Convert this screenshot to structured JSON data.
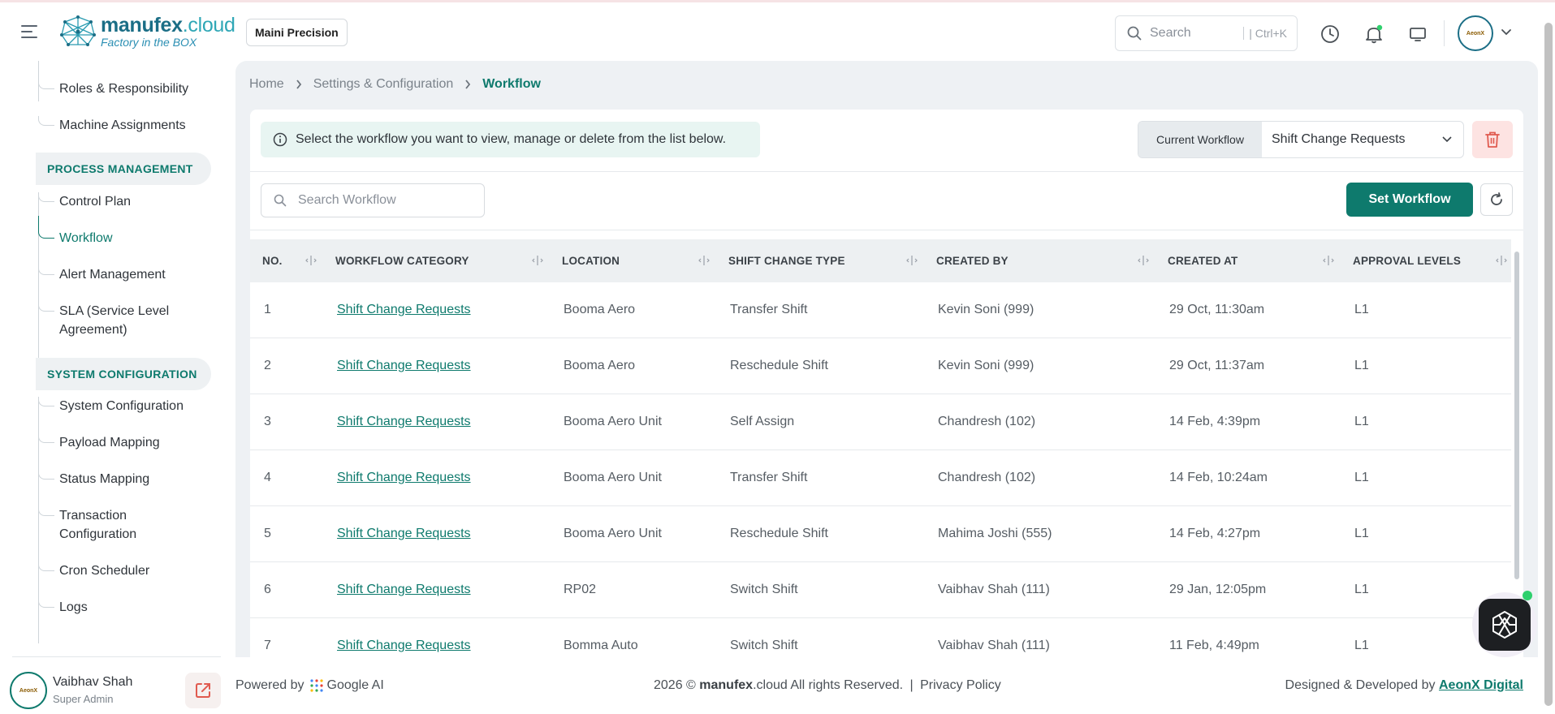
{
  "header": {
    "logo_name": "manufex",
    "logo_domain": ".cloud",
    "logo_tagline": "Factory in the BOX",
    "company": "Maini Precision",
    "search_placeholder": "Search",
    "search_shortcut": "| Ctrl+K",
    "icons": [
      "history-icon",
      "bell-icon",
      "monitor-icon"
    ],
    "avatar_text": "AeonX"
  },
  "sidebar": {
    "items_top": [
      "Roles & Responsibility",
      "Machine Assignments"
    ],
    "sections": [
      {
        "title": "PROCESS MANAGEMENT",
        "items": [
          "Control Plan",
          "Workflow",
          "Alert Management",
          "SLA (Service Level Agreement)"
        ]
      },
      {
        "title": "SYSTEM CONFIGURATION",
        "items": [
          "System Configuration",
          "Payload Mapping",
          "Status Mapping",
          "Transaction Configuration",
          "Cron Scheduler",
          "Logs"
        ]
      }
    ],
    "active_item": "Workflow",
    "user": {
      "name": "Vaibhav Shah",
      "role": "Super Admin",
      "avatar_text": "AeonX"
    }
  },
  "breadcrumb": [
    "Home",
    "Settings & Configuration",
    "Workflow"
  ],
  "main": {
    "info_text": "Select the workflow you want to view, manage or delete from the list below.",
    "current_workflow_label": "Current Workflow",
    "current_workflow_value": "Shift Change Requests",
    "search_placeholder": "Search Workflow",
    "set_workflow_label": "Set Workflow"
  },
  "table": {
    "columns": [
      "NO.",
      "WORKFLOW CATEGORY",
      "LOCATION",
      "SHIFT CHANGE TYPE",
      "CREATED BY",
      "CREATED AT",
      "APPROVAL LEVELS"
    ],
    "rows": [
      [
        "1",
        "Shift Change Requests",
        "Booma Aero",
        "Transfer Shift",
        "Kevin Soni (999)",
        "29 Oct, 11:30am",
        "L1"
      ],
      [
        "2",
        "Shift Change Requests",
        "Booma Aero",
        "Reschedule Shift",
        "Kevin Soni (999)",
        "29 Oct, 11:37am",
        "L1"
      ],
      [
        "3",
        "Shift Change Requests",
        "Booma Aero Unit",
        "Self Assign",
        "Chandresh (102)",
        "14 Feb, 4:39pm",
        "L1"
      ],
      [
        "4",
        "Shift Change Requests",
        "Booma Aero Unit",
        "Transfer Shift",
        "Chandresh (102)",
        "14 Feb, 10:24am",
        "L1"
      ],
      [
        "5",
        "Shift Change Requests",
        "Booma Aero Unit",
        "Reschedule Shift",
        "Mahima Joshi (555)",
        "14 Feb, 4:27pm",
        "L1"
      ],
      [
        "6",
        "Shift Change Requests",
        "RP02",
        "Switch Shift",
        "Vaibhav Shah (111)",
        "29 Jan, 12:05pm",
        "L1"
      ],
      [
        "7",
        "Shift Change Requests",
        "Bomma Auto",
        "Switch Shift",
        "Vaibhav Shah (111)",
        "11 Feb, 4:49pm",
        "L1"
      ]
    ]
  },
  "footer": {
    "powered_by": "Powered by",
    "powered_brand": "Google AI",
    "copyright_prefix": "2026 ©",
    "copyright_brand": "manufex",
    "copyright_suffix": ".cloud All rights Reserved.",
    "separator": "|",
    "privacy": "Privacy Policy",
    "designed_by": "Designed & Developed by",
    "designer": "AeonX Digital"
  },
  "colors": {
    "accent": "#0e7a6d",
    "brand": "#1b6e86",
    "danger": "#e05a4f"
  }
}
